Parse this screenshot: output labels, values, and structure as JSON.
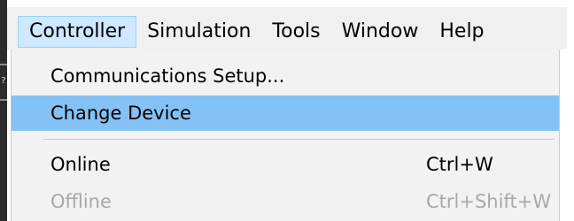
{
  "menubar": {
    "items": [
      {
        "label": "Controller",
        "active": true
      },
      {
        "label": "Simulation",
        "active": false
      },
      {
        "label": "Tools",
        "active": false
      },
      {
        "label": "Window",
        "active": false
      },
      {
        "label": "Help",
        "active": false
      }
    ]
  },
  "dropdown": {
    "items": [
      {
        "label": "Communications Setup...",
        "shortcut": "",
        "state": "normal"
      },
      {
        "label": "Change Device",
        "shortcut": "",
        "state": "highlighted"
      },
      {
        "label": "Online",
        "shortcut": "Ctrl+W",
        "state": "normal"
      },
      {
        "label": "Offline",
        "shortcut": "Ctrl+Shift+W",
        "state": "disabled"
      }
    ]
  },
  "left_strip": {
    "glyph": "?"
  },
  "colors": {
    "menubar_bg": "#f0f0f0",
    "active_menu_bg": "#cde8ff",
    "highlight_bg": "#84c1f5",
    "disabled_text": "#a8a8a8"
  }
}
